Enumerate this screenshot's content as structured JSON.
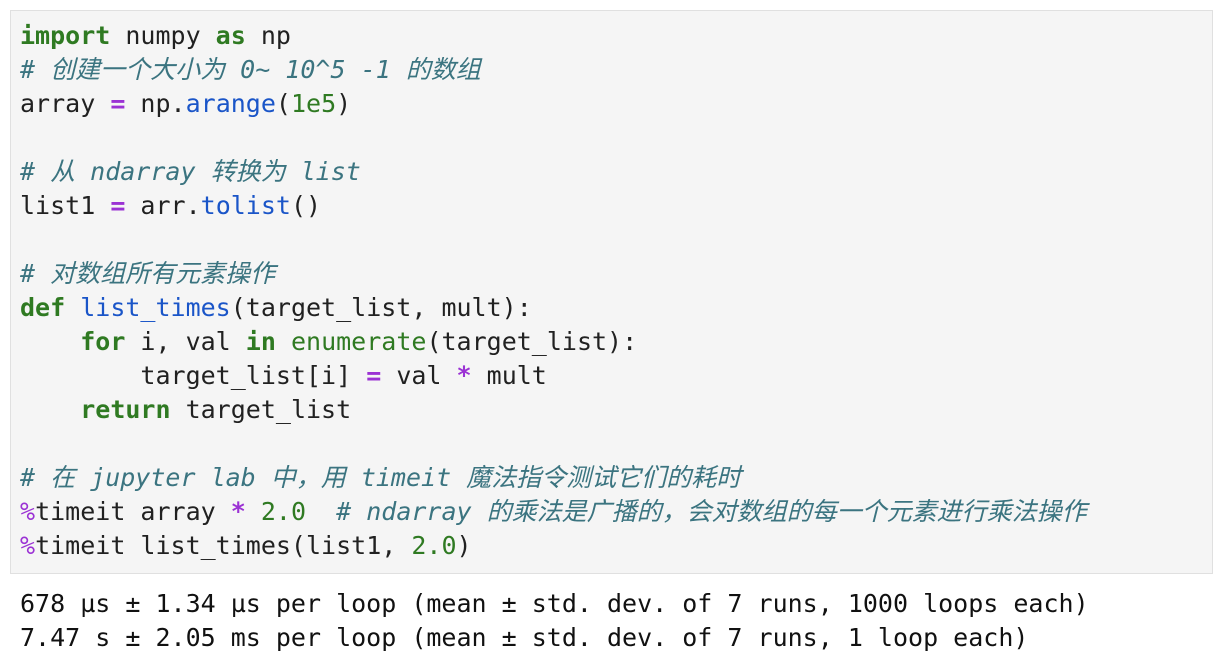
{
  "code": {
    "l1": {
      "kw1": "import",
      "t1": " numpy ",
      "kw2": "as",
      "t2": " np"
    },
    "l2": {
      "c": "# 创建一个大小为 0~ 10^5 -1 的数组"
    },
    "l3": {
      "t1": "array ",
      "op": "=",
      "t2": " np.",
      "fn": "arange",
      "t3": "(",
      "n": "1e5",
      "t4": ")"
    },
    "l5": {
      "c": "# 从 ndarray 转换为 list"
    },
    "l6": {
      "t1": "list1 ",
      "op": "=",
      "t2": " arr.",
      "fn": "tolist",
      "t3": "()"
    },
    "l8": {
      "c": "# 对数组所有元素操作"
    },
    "l9": {
      "kw": "def",
      "t1": " ",
      "fn": "list_times",
      "t2": "(target_list, mult):"
    },
    "l10": {
      "ind": "    ",
      "kw1": "for",
      "t1": " i, val ",
      "kw2": "in",
      "t2": " ",
      "bi": "enumerate",
      "t3": "(target_list):"
    },
    "l11": {
      "ind": "        ",
      "t1": "target_list[i] ",
      "op1": "=",
      "t2": " val ",
      "op2": "*",
      "t3": " mult"
    },
    "l12": {
      "ind": "    ",
      "kw": "return",
      "t1": " target_list"
    },
    "l14": {
      "c": "# 在 jupyter lab 中，用 timeit 魔法指令测试它们的耗时"
    },
    "l15": {
      "mg": "%",
      "t1": "timeit array ",
      "op": "*",
      "t2": " ",
      "n": "2.0",
      "t3": "  ",
      "c": "# ndarray 的乘法是广播的，会对数组的每一个元素进行乘法操作"
    },
    "l16": {
      "mg": "%",
      "t1": "timeit list_times(list1, ",
      "n": "2.0",
      "t2": ")"
    }
  },
  "output": {
    "line1": "678 µs ± 1.34 µs per loop (mean ± std. dev. of 7 runs, 1000 loops each)",
    "line2": "7.47 s ± 2.05 ms per loop (mean ± std. dev. of 7 runs, 1 loop each)"
  }
}
